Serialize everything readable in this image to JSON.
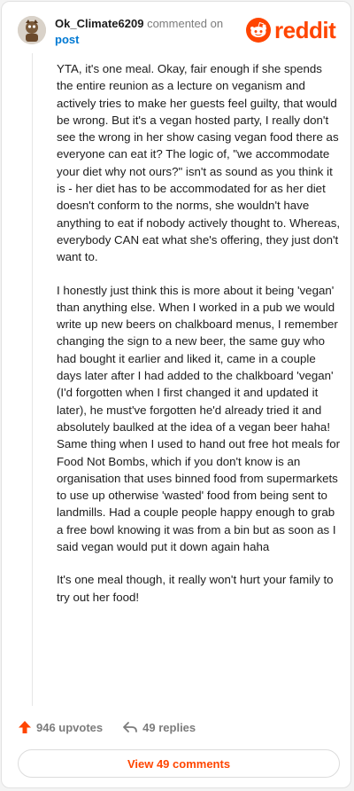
{
  "header": {
    "username": "Ok_Climate6209",
    "action": "commented on",
    "target": "post",
    "brand": "reddit"
  },
  "comment": {
    "paragraphs": [
      "YTA, it's one meal. Okay, fair enough if she spends the entire reunion as a lecture on veganism and actively tries to make her guests feel guilty, that would be wrong. But it's a vegan hosted party, I really don't see the wrong in her show casing vegan food there as everyone can eat it? The logic of, \"we accommodate your diet why not ours?\" isn't as sound as you think it is - her diet has to be accommodated for as her diet doesn't conform to the norms, she wouldn't have anything to eat if nobody actively thought to. Whereas, everybody CAN eat what she's offering, they just don't want to.",
      "I honestly just think this is more about it being 'vegan' than anything else. When I worked in a pub we would write up new beers on chalkboard menus, I remember changing the sign to a new beer, the same guy who had bought it earlier and liked it, came in a couple days later after I had added to the chalkboard 'vegan' (I'd forgotten when I first changed it and updated it later), he must've forgotten he'd already tried it and absolutely baulked at the idea of a vegan beer haha! Same thing when I used to hand out free hot meals for Food Not Bombs, which if you don't know is an organisation that uses binned food from supermarkets to use up otherwise 'wasted' food from being sent to landmills. Had a couple people happy enough to grab a free bowl knowing it was from a bin but as soon as I said vegan would put it down again haha",
      "It's one meal though, it really won't hurt your family to try out her food!"
    ]
  },
  "footer": {
    "upvotes": "946 upvotes",
    "replies": "49 replies",
    "view_comments": "View 49 comments"
  },
  "colors": {
    "accent": "#ff4500",
    "link": "#0079d3",
    "muted": "#7c7c7c"
  },
  "icons": [
    "avatar-icon",
    "reddit-logo-icon",
    "upvote-arrow-icon",
    "reply-arrow-icon"
  ]
}
